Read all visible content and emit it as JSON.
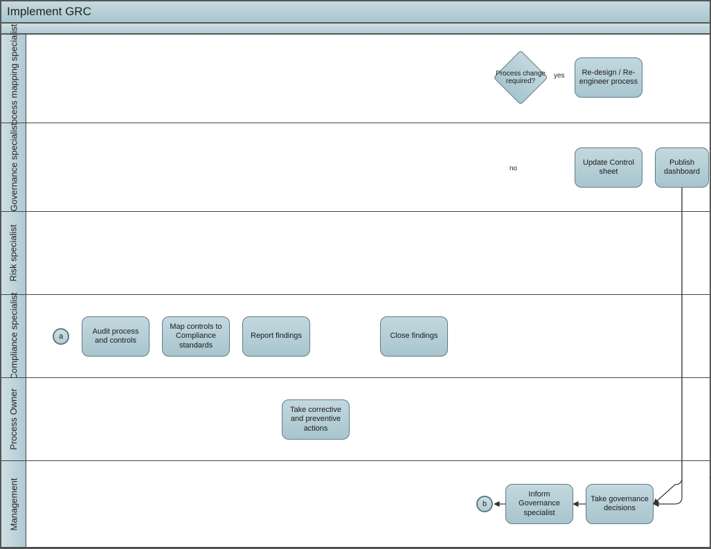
{
  "pool_title": "Implement GRC",
  "lanes": [
    {
      "id": "pm",
      "label": "Process mapping specialist"
    },
    {
      "id": "gov",
      "label": "Governance specialist"
    },
    {
      "id": "risk",
      "label": "Risk specialist"
    },
    {
      "id": "comp",
      "label": "Compliance specialist"
    },
    {
      "id": "po",
      "label": "Process Owner"
    },
    {
      "id": "mgmt",
      "label": "Management"
    }
  ],
  "tasks": {
    "audit": "Audit process and controls",
    "map": "Map controls to Compliance standards",
    "report": "Report findings",
    "capa": "Take corrective and preventive actions",
    "close": "Close findings",
    "redesign": "Re-design  /  Re-engineer process",
    "update": "Update Control sheet",
    "publish": "Publish dashboard",
    "decide": "Take governance decisions",
    "inform": "Inform Governance specialist"
  },
  "gateway": {
    "change": "Process change required?"
  },
  "events": {
    "start": "a",
    "end": "b"
  },
  "edge_labels": {
    "yes": "yes",
    "no": "no"
  }
}
